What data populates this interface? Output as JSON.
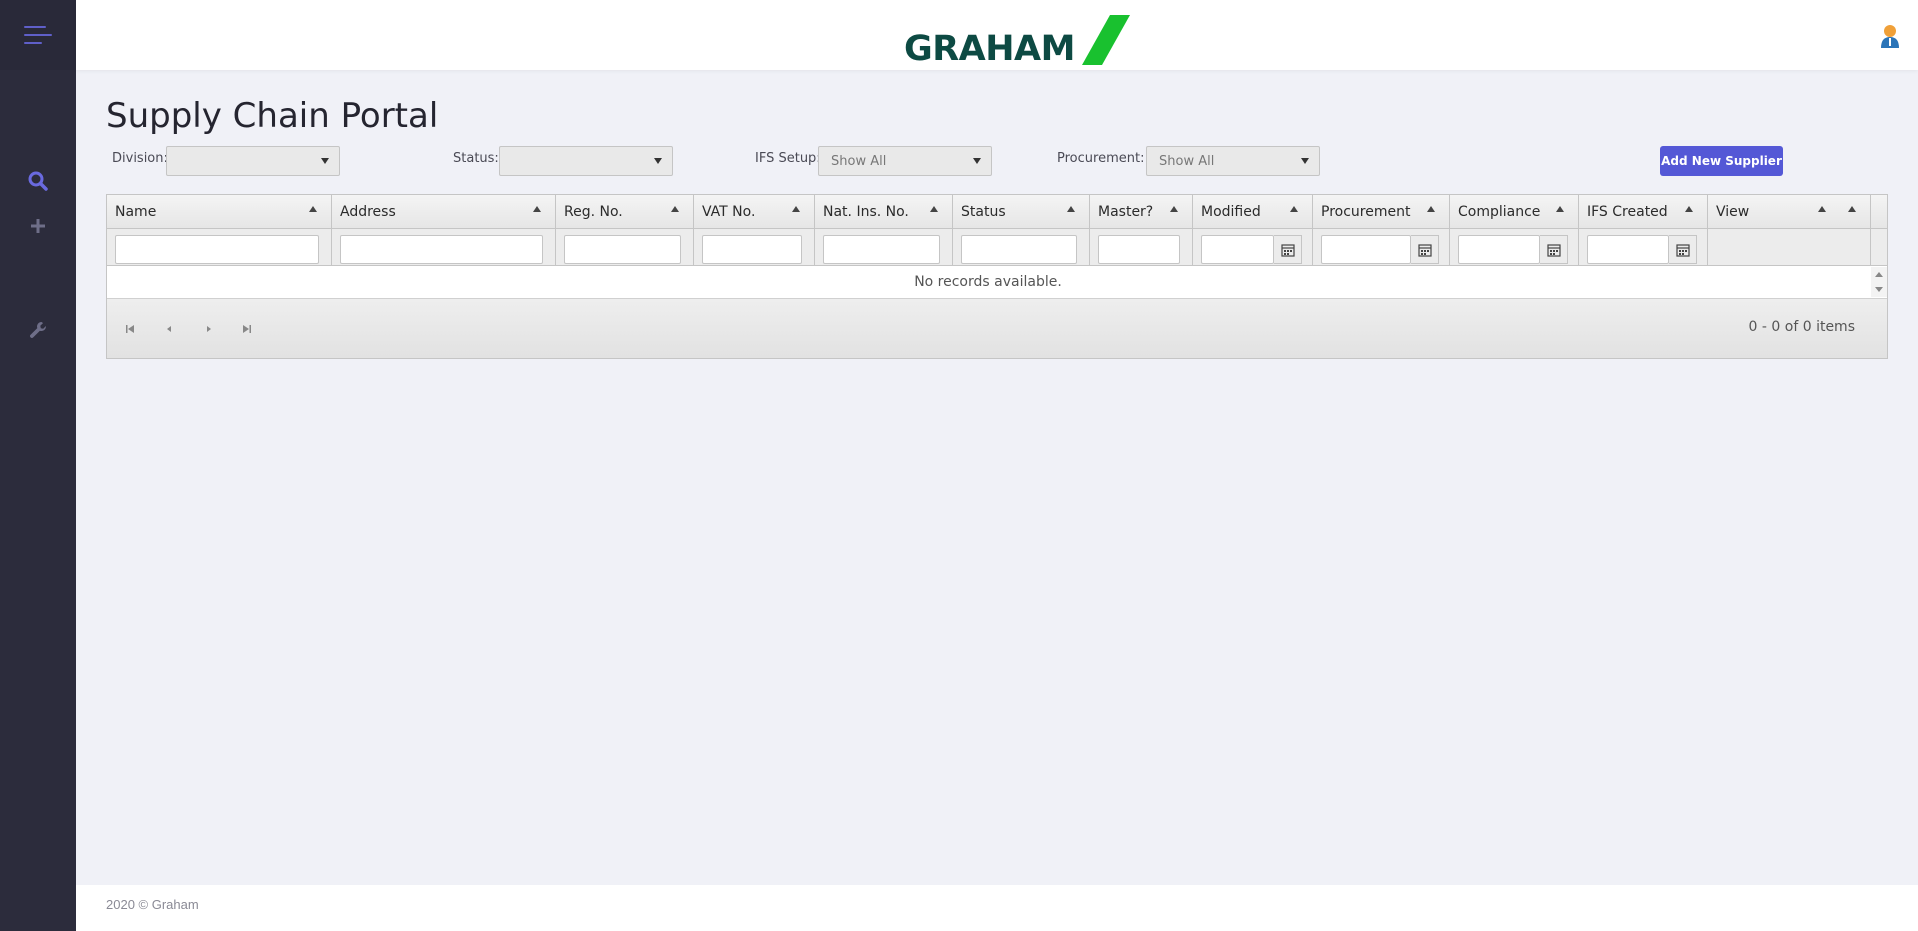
{
  "header": {
    "logo_text": "GRAHAM",
    "brand_colors": {
      "text": "#0d4a43",
      "slash": "#19c12f"
    }
  },
  "sidebar": {
    "items": [
      {
        "icon": "search-icon",
        "label": "Search"
      },
      {
        "icon": "plus-icon",
        "label": "Add"
      },
      {
        "icon": "wrench-icon",
        "label": "Settings"
      }
    ]
  },
  "page": {
    "title": "Supply Chain Portal"
  },
  "filters": {
    "division_label": "Division:",
    "division_value": "",
    "status_label": "Status:",
    "status_value": "",
    "ifs_label": "IFS Setup:",
    "ifs_value": "Show All",
    "procurement_label": "Procurement:",
    "procurement_value": "Show All"
  },
  "actions": {
    "add_supplier": "Add New Supplier",
    "accent": "#5458d6"
  },
  "grid": {
    "columns": [
      "Name",
      "Address",
      "Reg. No.",
      "VAT No.",
      "Nat. Ins. No.",
      "Status",
      "Master?",
      "Modified",
      "Procurement",
      "Compliance",
      "IFS Created",
      "View"
    ],
    "empty_message": "No records available.",
    "pager_info": "0 - 0 of 0 items"
  },
  "footer": {
    "text": "2020 © Graham"
  }
}
